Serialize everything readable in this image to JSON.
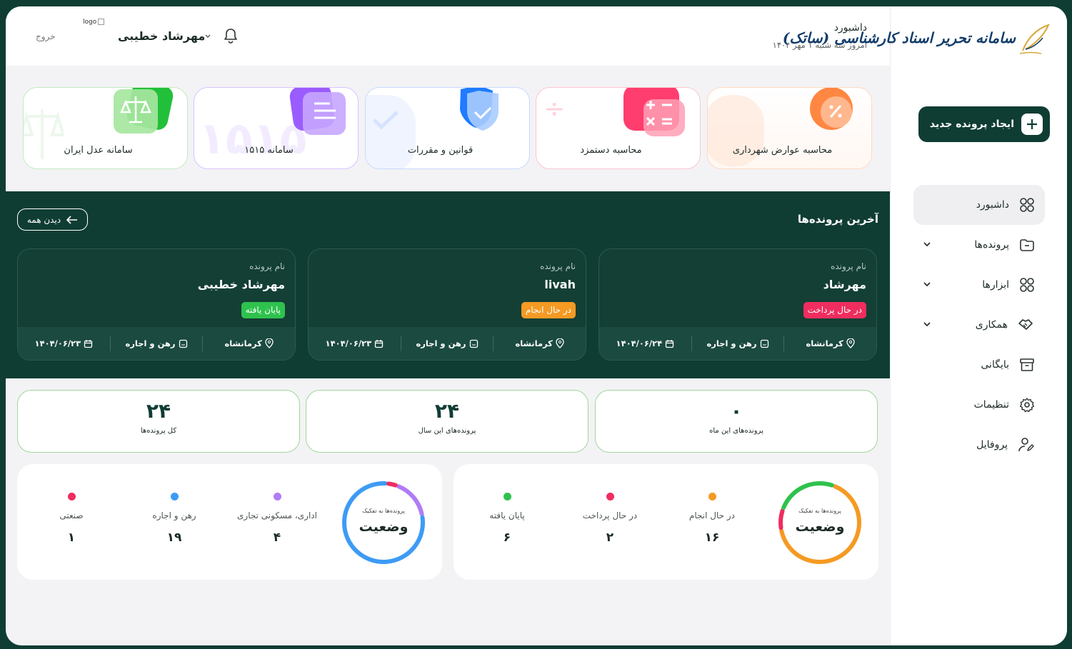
{
  "brand": {
    "name": "سامانه تحریر اسناد کارشناسی (ساتک)"
  },
  "header": {
    "title": "داشبورد",
    "date": "امروز سه شنبه ۱ مهر ۱۴۰۴",
    "user": "مهرشاد خطیبی",
    "logo_alt": "logo",
    "logout": "خروج"
  },
  "sidebar": {
    "new_button": "ایجاد پرونده جدید",
    "items": [
      {
        "label": "داشبورد",
        "icon": "grid-icon",
        "active": true
      },
      {
        "label": "پرونده‌ها",
        "icon": "folder-icon",
        "expand": true
      },
      {
        "label": "ابزارها",
        "icon": "grid-icon",
        "expand": true
      },
      {
        "label": "همکاری",
        "icon": "handshake-icon",
        "expand": true
      },
      {
        "label": "بایگانی",
        "icon": "archive-icon"
      },
      {
        "label": "تنظیمات",
        "icon": "gear-icon"
      },
      {
        "label": "پروفایل",
        "icon": "user-icon"
      }
    ]
  },
  "tools": [
    {
      "label": "محاسبه عوارض شهرداری",
      "color": "#ff8a3d"
    },
    {
      "label": "محاسبه دستمزد",
      "color": "#ff3d6e"
    },
    {
      "label": "قوانین و مقررات",
      "color": "#3d8bff"
    },
    {
      "label": "سامانه ۱۵۱۵",
      "color": "#a066ff"
    },
    {
      "label": "سامانه عدل ایران",
      "color": "#3dc94a"
    }
  ],
  "recent": {
    "title": "آخرین پرونده‌ها",
    "see_all": "دیدن همه",
    "caption": "نام پرونده",
    "files": [
      {
        "name": "مهرشاد",
        "status": "در حال پرداخت",
        "status_color": "#ef2d5e",
        "city": "کرمانشاه",
        "type": "رهن و اجاره",
        "date": "۱۴۰۴/۰۶/۲۴"
      },
      {
        "name": "livah",
        "status": "در حال انجام",
        "status_color": "#f59a23",
        "city": "کرمانشاه",
        "type": "رهن و اجاره",
        "date": "۱۴۰۴/۰۶/۲۳"
      },
      {
        "name": "مهرشاد خطیبی",
        "status": "پایان یافته",
        "status_color": "#2ec24d",
        "city": "کرمانشاه",
        "type": "رهن و اجاره",
        "date": "۱۴۰۴/۰۶/۲۳"
      }
    ]
  },
  "stats": [
    {
      "value": "۰",
      "label": "پرونده‌های این ماه"
    },
    {
      "value": "۲۴",
      "label": "پرونده‌های این سال"
    },
    {
      "value": "۲۴",
      "label": "کل پرونده‌ها"
    }
  ],
  "status_panels": [
    {
      "subtitle": "پرونده‌ها به تفکیک",
      "title": "وضعیت",
      "items": [
        {
          "label": "در حال انجام",
          "value": "۱۶",
          "number": 16,
          "color": "#f59a23"
        },
        {
          "label": "در حال پرداخت",
          "value": "۲",
          "number": 2,
          "color": "#ef2d5e"
        },
        {
          "label": "پایان یافته",
          "value": "۶",
          "number": 6,
          "color": "#2ec24d"
        }
      ]
    },
    {
      "subtitle": "پرونده‌ها به تفکیک",
      "title": "وضعیت",
      "items": [
        {
          "label": "اداری، مسکونی تجاری",
          "value": "۴",
          "number": 4,
          "color": "#b07cf7"
        },
        {
          "label": "رهن و اجاره",
          "value": "۱۹",
          "number": 19,
          "color": "#3d9bf5"
        },
        {
          "label": "صنعتی",
          "value": "۱",
          "number": 1,
          "color": "#ef2d5e"
        }
      ]
    }
  ]
}
